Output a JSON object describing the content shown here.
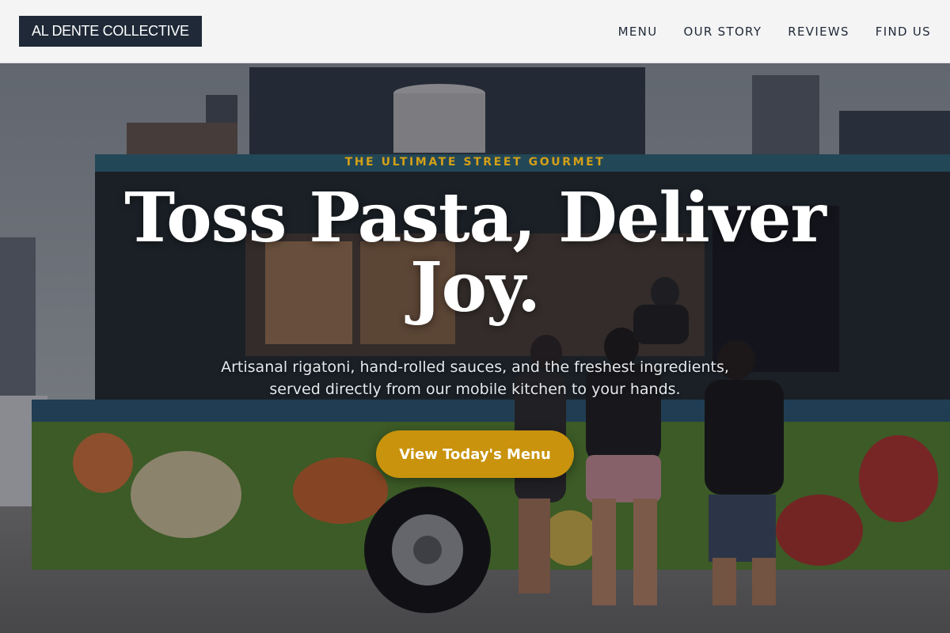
{
  "brand": {
    "name": "AL DENTE COLLECTIVE"
  },
  "nav": {
    "items": [
      {
        "label": "MENU"
      },
      {
        "label": "OUR STORY"
      },
      {
        "label": "REVIEWS"
      },
      {
        "label": "FIND US"
      }
    ]
  },
  "hero": {
    "eyebrow": "THE ULTIMATE STREET GOURMET",
    "headline": "Toss Pasta, Deliver Joy.",
    "subtitle": "Artisanal rigatoni, hand-rolled sauces, and the freshest ingredients, served directly from our mobile kitchen to your hands.",
    "cta_label": "View Today's Menu",
    "background_image": "food-truck-photo"
  },
  "colors": {
    "accent": "#c9930d",
    "eyebrow": "#d4a017",
    "logo_bg": "#1f2937",
    "header_bg": "#f4f4f5"
  }
}
